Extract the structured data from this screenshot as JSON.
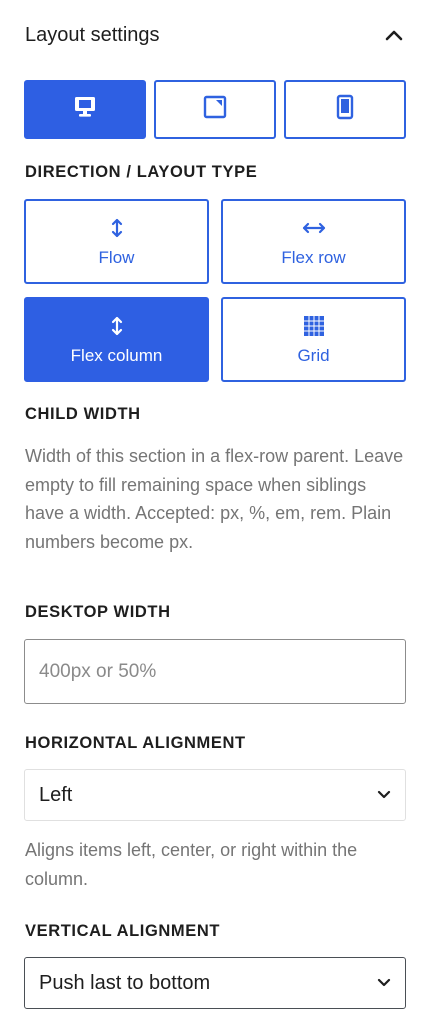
{
  "header": {
    "title": "Layout settings",
    "toggle_icon": "chevron-up-icon"
  },
  "devices": [
    {
      "name": "desktop",
      "icon": "desktop-icon",
      "active": true
    },
    {
      "name": "tablet",
      "icon": "tablet-icon",
      "active": false
    },
    {
      "name": "mobile",
      "icon": "mobile-icon",
      "active": false
    }
  ],
  "direction": {
    "label": "DIRECTION / LAYOUT TYPE",
    "options": [
      {
        "label": "Flow",
        "icon": "vertical-arrows-icon",
        "active": false
      },
      {
        "label": "Flex row",
        "icon": "horizontal-arrows-icon",
        "active": false
      },
      {
        "label": "Flex column",
        "icon": "vertical-arrows-icon",
        "active": true
      },
      {
        "label": "Grid",
        "icon": "grid-icon",
        "active": false
      }
    ]
  },
  "child_width": {
    "label": "CHILD WIDTH",
    "help": "Width of this section in a flex-row parent. Leave empty to fill remaining space when siblings have a width. Accepted: px, %, em, rem. Plain numbers become px."
  },
  "desktop_width": {
    "label": "DESKTOP WIDTH",
    "value": "",
    "placeholder": "400px or 50%"
  },
  "horizontal_alignment": {
    "label": "HORIZONTAL ALIGNMENT",
    "value": "Left",
    "help": "Aligns items left, center, or right within the column."
  },
  "vertical_alignment": {
    "label": "VERTICAL ALIGNMENT",
    "value": "Push last to bottom"
  },
  "colors": {
    "accent": "#2e5fe3",
    "muted_text": "#757575",
    "text": "#1e1e1e"
  }
}
